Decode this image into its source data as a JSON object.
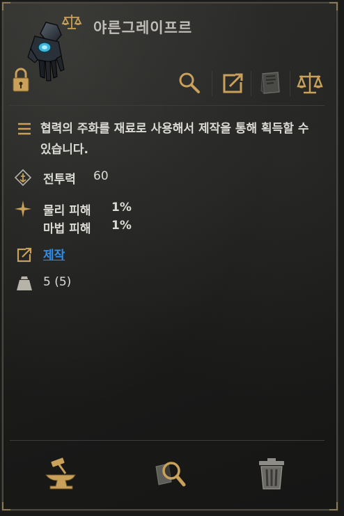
{
  "item": {
    "name": "야른그레이프르",
    "description": "협력의 주화를 재료로 사용해서 제작을 통해 획득할 수 있습니다."
  },
  "stats": {
    "combat_power_label": "전투력",
    "combat_power_value": "60",
    "physical_damage_label": "물리 피해",
    "physical_damage_value": "1%",
    "magic_damage_label": "마법 피해",
    "magic_damage_value": "1%"
  },
  "source": {
    "craft_link": "제작"
  },
  "weight": {
    "value": "5 (5)"
  },
  "icons": {
    "item": "gauntlet-icon",
    "lock": "lock-icon",
    "trade": "scale-icon",
    "search": "magnifier-icon",
    "link": "external-link-icon",
    "map": "map-icon",
    "weight": "weight-icon",
    "list": "list-icon",
    "combat": "combat-power-icon",
    "star": "sparkle-icon",
    "anvil": "anvil-hammer-icon",
    "inspect": "inspect-icon",
    "trash": "trash-icon"
  },
  "colors": {
    "link": "#2f8fe8",
    "gold": "#c9a15a",
    "text": "#dcdad4"
  }
}
